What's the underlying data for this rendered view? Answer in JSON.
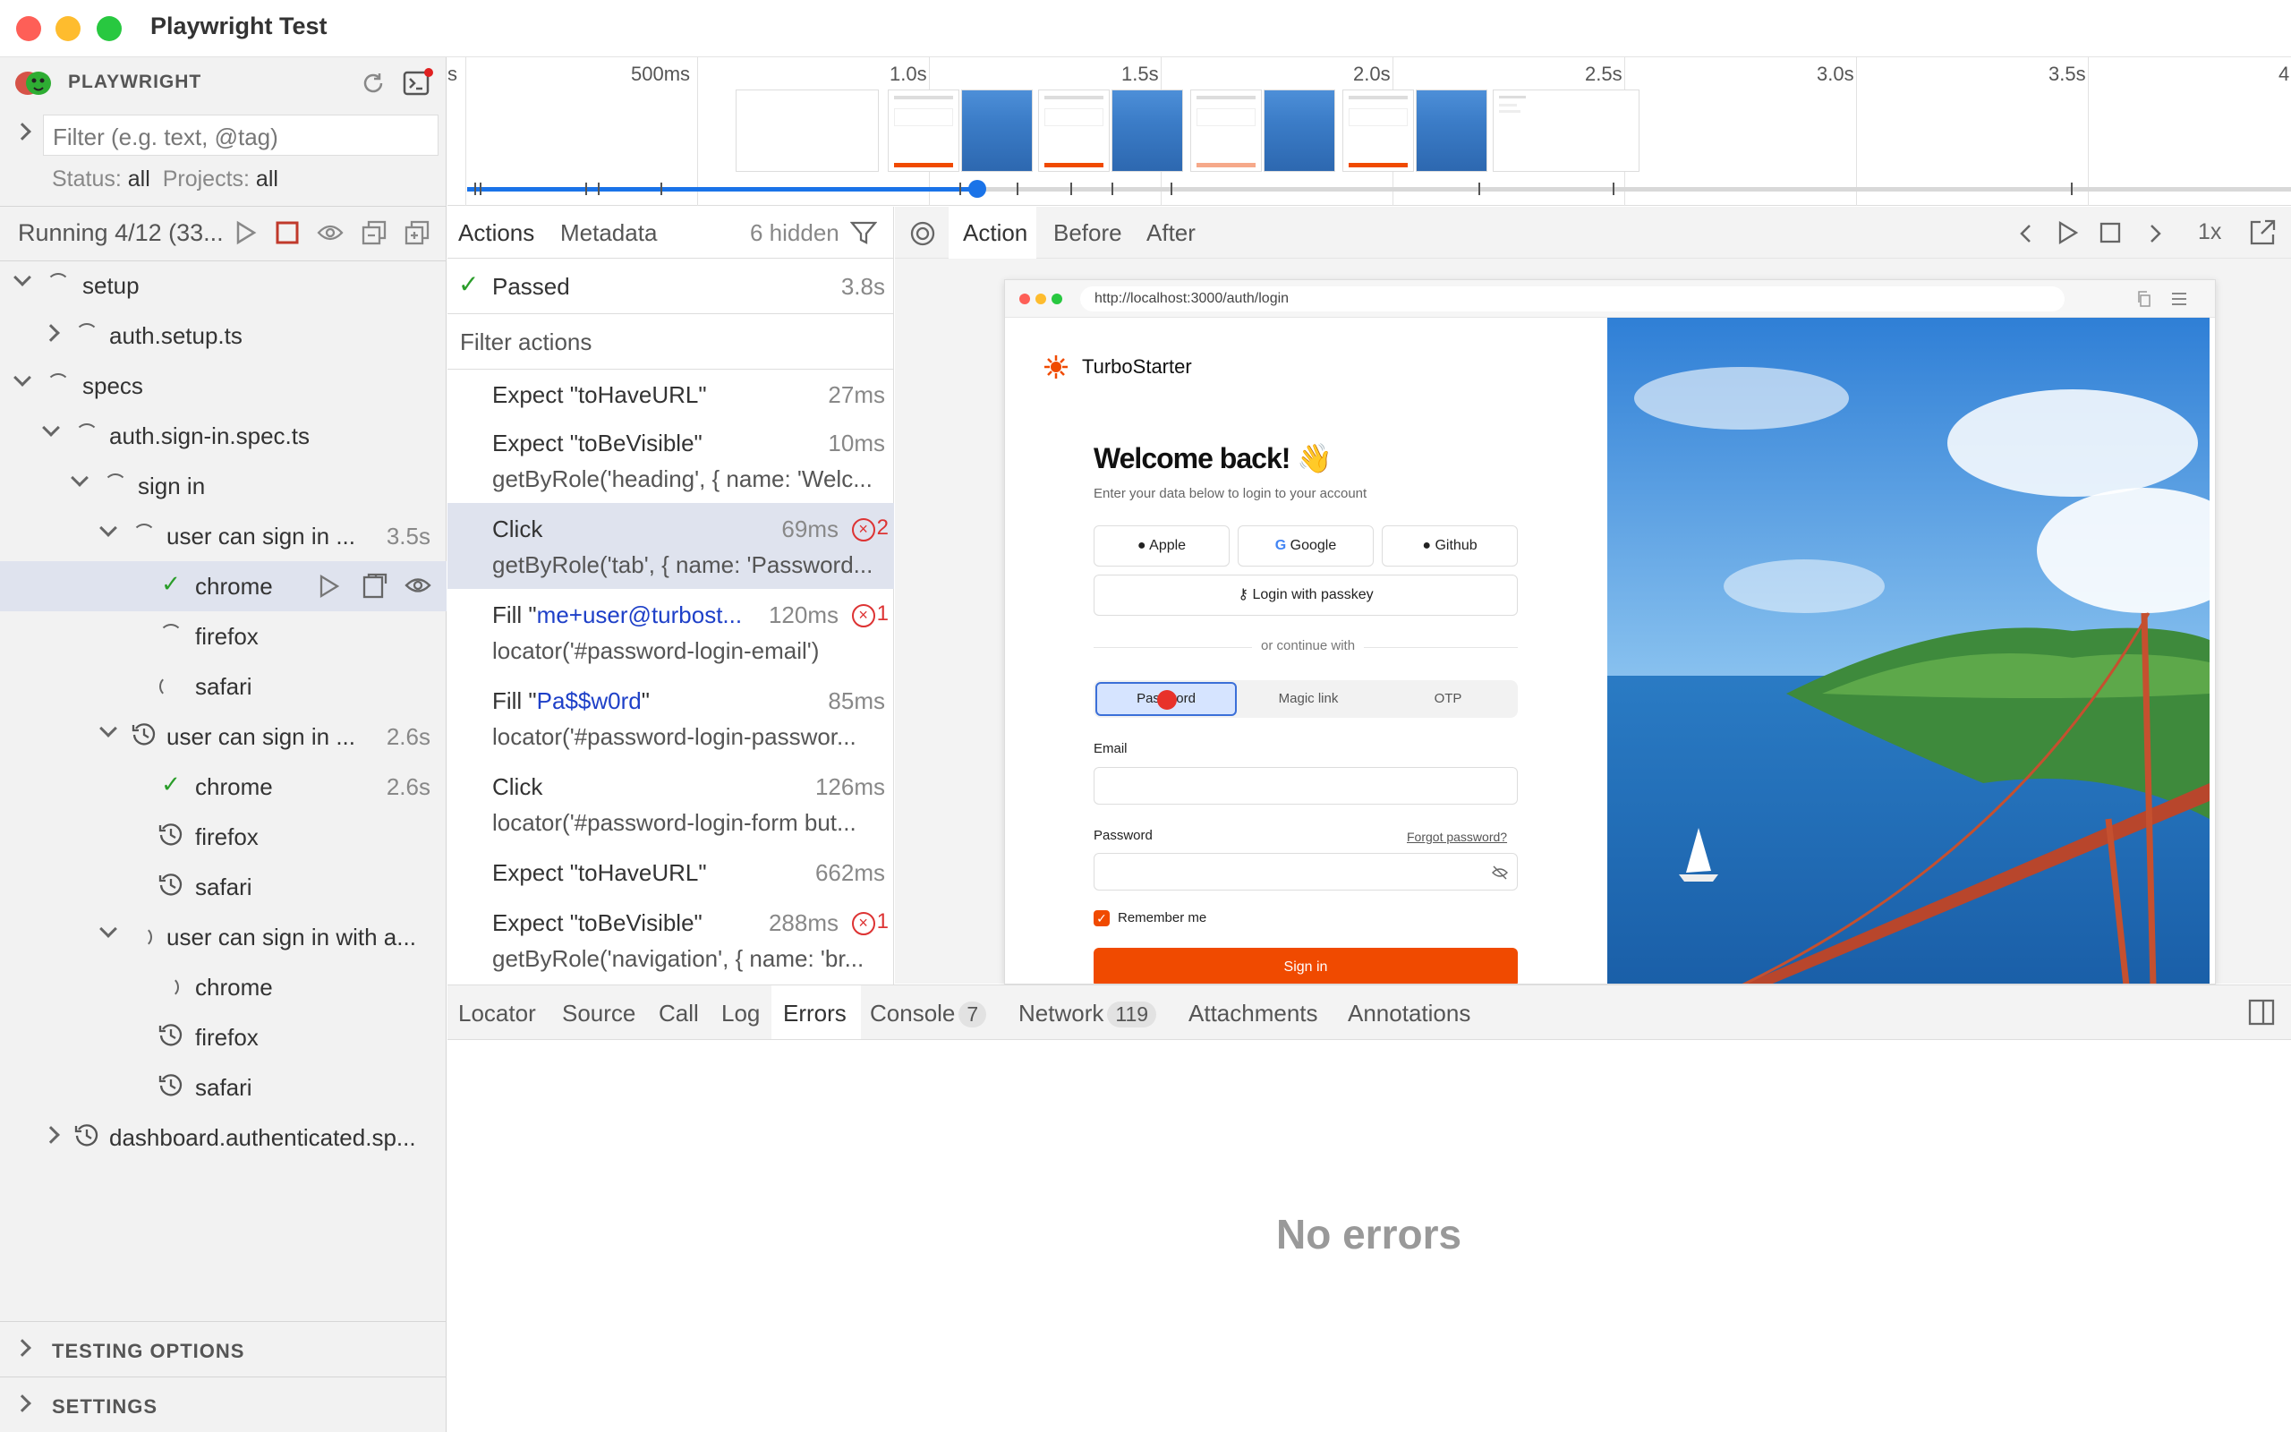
{
  "window": {
    "title": "Playwright Test"
  },
  "sidebar": {
    "brand": "PLAYWRIGHT",
    "filter_placeholder": "Filter (e.g. text, @tag)",
    "status_label": "Status:",
    "status_value": "all",
    "projects_label": "Projects:",
    "projects_value": "all",
    "running": "Running 4/12 (33...",
    "tree": [
      {
        "label": "setup"
      },
      {
        "label": "auth.setup.ts"
      },
      {
        "label": "specs"
      },
      {
        "label": "auth.sign-in.spec.ts"
      },
      {
        "label": "sign in"
      },
      {
        "label": "user can sign in ...",
        "dur": "3.5s"
      },
      {
        "label": "chrome"
      },
      {
        "label": "firefox"
      },
      {
        "label": "safari"
      },
      {
        "label": "user can sign in ...",
        "dur": "2.6s"
      },
      {
        "label": "chrome",
        "dur": "2.6s"
      },
      {
        "label": "firefox"
      },
      {
        "label": "safari"
      },
      {
        "label": "user can sign in with a..."
      },
      {
        "label": "chrome"
      },
      {
        "label": "firefox"
      },
      {
        "label": "safari"
      },
      {
        "label": "dashboard.authenticated.sp..."
      }
    ],
    "testing_options": "TESTING OPTIONS",
    "settings": "SETTINGS"
  },
  "timeline": {
    "labels": [
      "s",
      "500ms",
      "1.0s",
      "1.5s",
      "2.0s",
      "2.5s",
      "3.0s",
      "3.5s",
      "4"
    ]
  },
  "actions_panel": {
    "tab_actions": "Actions",
    "tab_metadata": "Metadata",
    "hidden": "6 hidden",
    "passed": "Passed",
    "passed_dur": "3.8s",
    "filter_placeholder": "Filter actions",
    "items": [
      {
        "title": "Expect \"toHaveURL\"",
        "ms": "27ms"
      },
      {
        "title": "Expect \"toBeVisible\"",
        "ms": "10ms",
        "sub": "getByRole('heading', { name: 'Welc..."
      },
      {
        "title": "Click",
        "ms": "69ms",
        "err": "2",
        "sub": "getByRole('tab', { name: 'Password..."
      },
      {
        "title_pre": "Fill \"",
        "title_val": "me+user@turbost...",
        "ms": "120ms",
        "err": "1",
        "sub": "locator('#password-login-email')"
      },
      {
        "title_pre": "Fill \"",
        "title_val": "Pa$$w0rd",
        "title_post": "\"",
        "ms": "85ms",
        "sub": "locator('#password-login-passwor..."
      },
      {
        "title": "Click",
        "ms": "126ms",
        "sub": "locator('#password-login-form but..."
      },
      {
        "title": "Expect \"toHaveURL\"",
        "ms": "662ms"
      },
      {
        "title": "Expect \"toBeVisible\"",
        "ms": "288ms",
        "err": "1",
        "sub": "getByRole('navigation', { name: 'br..."
      }
    ]
  },
  "snapshot": {
    "tab_action": "Action",
    "tab_before": "Before",
    "tab_after": "After",
    "speed": "1x",
    "url": "http://localhost:3000/auth/login",
    "brand": "TurboStarter",
    "heading": "Welcome back! 👋",
    "subheading": "Enter your data below to login to your account",
    "apple": "Apple",
    "google": "Google",
    "github": "Github",
    "passkey": "Login with passkey",
    "divider": "or continue with",
    "tab_password": "Password",
    "tab_magic": "Magic link",
    "tab_otp": "OTP",
    "email_label": "Email",
    "password_label": "Password",
    "forgot": "Forgot password?",
    "remember": "Remember me",
    "signin": "Sign in"
  },
  "bottom": {
    "tabs": [
      "Locator",
      "Source",
      "Call",
      "Log",
      "Errors",
      "Console",
      "Network",
      "Attachments",
      "Annotations"
    ],
    "console_count": "7",
    "network_count": "119",
    "empty": "No errors"
  },
  "colors": {
    "accent": "#1a73e8",
    "error": "#dd3333",
    "brand_orange": "#f04a00",
    "pass": "#2a9d2a"
  }
}
